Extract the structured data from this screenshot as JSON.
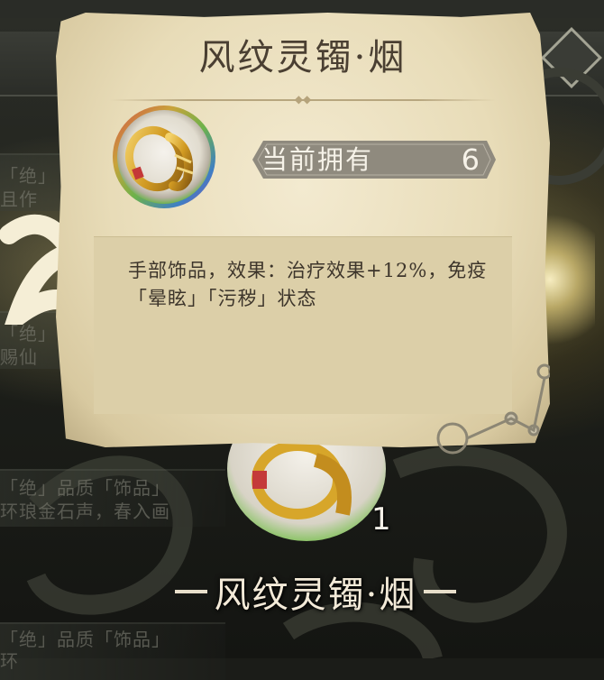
{
  "popup": {
    "title": "风纹灵镯·烟",
    "owned_label": "当前拥有",
    "owned_count": "6",
    "description": "手部饰品，效果：治疗效果+12%，免疫「晕眩」「污秽」状态",
    "icon": "gold-bracelet-icon"
  },
  "background": {
    "item_count": "1",
    "item_title": "风纹灵镯·烟",
    "list_rows": [
      "「绝」",
      "且作",
      "「绝」",
      "赐仙",
      "「绝」品质「饰品」",
      "环琅金石声，春入画",
      "「绝」品质「饰品」",
      "环"
    ]
  },
  "colors": {
    "paper": "#ece1c2",
    "title_text": "#4a3f32",
    "owned_bar": "#8f8a7e",
    "desc_bg": "#dccfa8",
    "gold": "#d6a52c"
  }
}
